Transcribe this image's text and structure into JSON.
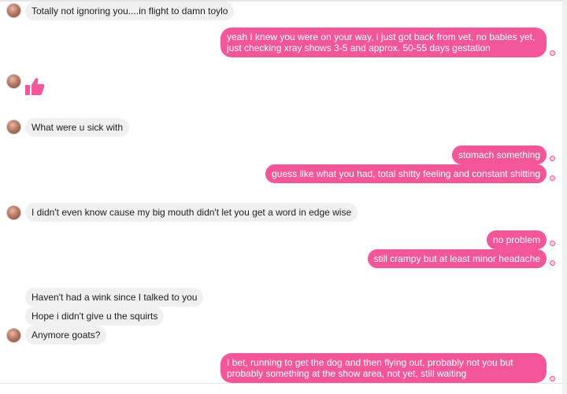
{
  "messages": {
    "m1": "Totally not ignoring you....in flight to damn toylo",
    "m2": "yeah I knew you were on your way, i just got back from vet, no babies yet, just checking xray shows 3-5 and approx. 50-55 days gestation",
    "m3": "What were u sick with",
    "m4": "stomach something",
    "m5": "guess like what you had, total shitty feeling and constant shitting",
    "m6": "I didn't even know cause my big mouth didn't let you get a word in edge wise",
    "m7": "no problem",
    "m8": "still crampy but at least minor headache",
    "m9": "Haven't had a wink since I talked to you",
    "m10": "Hope i didn't give u the squirts",
    "m11": "Anymore goats?",
    "m12": "I bet, running to get the dog and then flying out, probably not you but probably something at the show area, not yet, still waiting"
  },
  "colors": {
    "outgoing_bubble": "#f4569a",
    "incoming_bubble": "#f1f0f0"
  },
  "icons": {
    "like": "thumbs-up-icon",
    "avatar": "contact-avatar",
    "seen": "seen-indicator-icon"
  }
}
